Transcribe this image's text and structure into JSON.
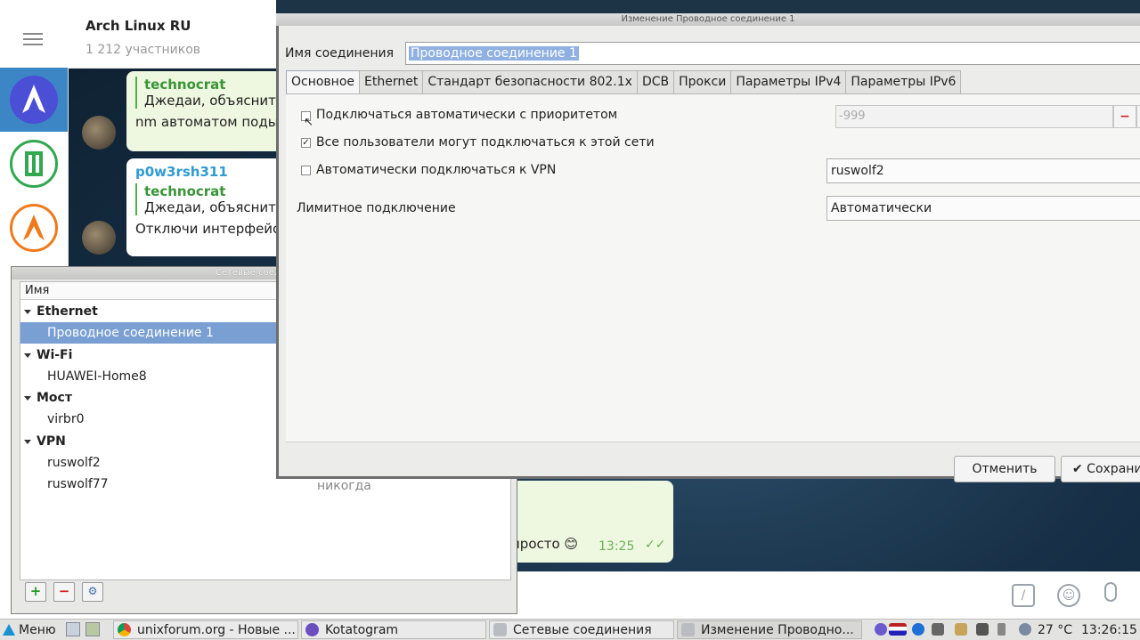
{
  "telegram": {
    "chat_title": "Arch Linux RU",
    "members": "1 212 участников",
    "messages": [
      {
        "reply_author": "technocrat",
        "reply_text": "Джедаи, объяснит",
        "text": "nm автоматом поды"
      },
      {
        "author": "p0w3rsh311",
        "reply_author": "technocrat",
        "reply_text": "Джедаи, объяснит",
        "text": "Отключи интерфейс"
      },
      {
        "text": "просто 😊",
        "time": "13:25",
        "status": "✓✓"
      }
    ],
    "input_icons": [
      "command-icon",
      "emoji-icon",
      "mic-icon"
    ]
  },
  "netwin": {
    "title": "Сетевые соединения",
    "column_name": "Имя",
    "groups": [
      {
        "label": "Ethernet",
        "items": [
          "Проводное соединение 1"
        ]
      },
      {
        "label": "Wi-Fi",
        "items": [
          "HUAWEI-Home8"
        ]
      },
      {
        "label": "Мост",
        "items": [
          "virbr0"
        ]
      },
      {
        "label": "VPN",
        "items": [
          "ruswolf2",
          "ruswolf77"
        ]
      }
    ],
    "last_used": "никогда"
  },
  "dialog": {
    "title": "Изменение Проводное соединение 1",
    "conn_label": "Имя соединения",
    "conn_value": "Проводное соединение 1",
    "tabs": [
      "Основное",
      "Ethernet",
      "Стандарт безопасности 802.1x",
      "DCB",
      "Прокси",
      "Параметры IPv4",
      "Параметры IPv6"
    ],
    "auto_connect_label": "Подключаться автоматически с приоритетом",
    "priority_value": "-999",
    "all_users_label": "Все пользователи могут подключаться к этой сети",
    "vpn_label": "Автоматически подключаться к VPN",
    "vpn_value": "ruswolf2",
    "metered_label": "Лимитное подключение",
    "metered_value": "Автоматически",
    "cancel": "Отменить",
    "save": "✔ Сохрани"
  },
  "taskbar": {
    "menu": "Меню",
    "tasks": [
      "unixforum.org - Новые ...",
      "Kotatogram",
      "Сетевые соединения",
      "Изменение Проводно..."
    ],
    "temperature": "27 °C",
    "clock": "13:26:15"
  },
  "colors": {
    "selection": "#7a9fd3",
    "telegram_green": "#3a9438",
    "link_blue": "#2f9bd3"
  }
}
